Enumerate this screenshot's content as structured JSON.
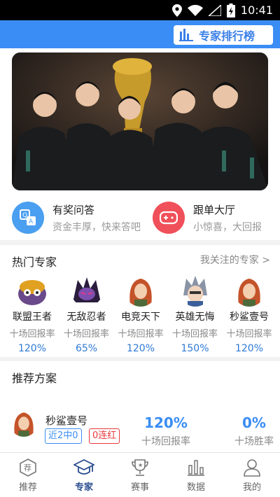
{
  "status_bar": {
    "time": "10:41"
  },
  "header": {
    "ranking_button": "专家排行榜"
  },
  "quick_links": [
    {
      "title": "有奖问答",
      "subtitle": "资金丰厚，快来答吧",
      "icon": "qa-icon",
      "color": "#4a9ff0"
    },
    {
      "title": "跟单大厅",
      "subtitle": "小惊喜，大回报",
      "icon": "gamepad-icon",
      "color": "#f0505a"
    }
  ],
  "hot_experts": {
    "title": "热门专家",
    "follow_link": "我关注的专家 >",
    "items": [
      {
        "name": "联盟王者",
        "label": "十场回报率",
        "rate": "120%"
      },
      {
        "name": "无敌忍者",
        "label": "十场回报率",
        "rate": "65%"
      },
      {
        "name": "电竞天下",
        "label": "十场回报率",
        "rate": "120%"
      },
      {
        "name": "英雄无悔",
        "label": "十场回报率",
        "rate": "150%"
      },
      {
        "name": "秒鲨壹号",
        "label": "十场回报率",
        "rate": "120%"
      }
    ]
  },
  "recommend": {
    "title": "推荐方案",
    "item": {
      "name": "秒鲨壹号",
      "tag_recent": "近2中0",
      "tag_streak": "0连红",
      "return_value": "120%",
      "return_label": "十场回报率",
      "win_value": "0%",
      "win_label": "十场胜率"
    }
  },
  "tabs": [
    {
      "label": "推荐",
      "icon": "recommend-icon",
      "active": false
    },
    {
      "label": "专家",
      "icon": "graduation-cap-icon",
      "active": true
    },
    {
      "label": "赛事",
      "icon": "trophy-icon",
      "active": false
    },
    {
      "label": "数据",
      "icon": "bar-chart-icon",
      "active": false
    },
    {
      "label": "我的",
      "icon": "user-icon",
      "active": false
    }
  ],
  "colors": {
    "header": "#3a8df4",
    "accent": "#3a8df4",
    "tab_active": "#2a4d8f",
    "red_tag": "#e8383d"
  }
}
